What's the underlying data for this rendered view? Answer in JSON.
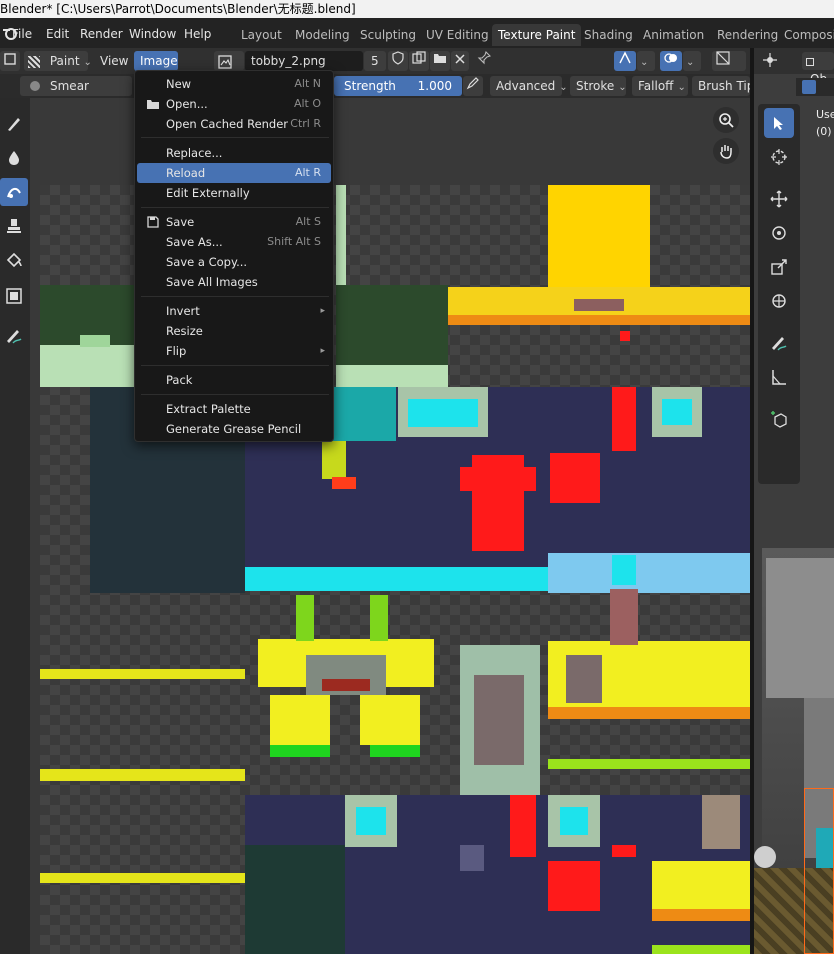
{
  "window": {
    "title": "Blender* [C:\\Users\\Parrot\\Documents\\Blender\\无标题.blend]"
  },
  "menubar": {
    "items": [
      "File",
      "Edit",
      "Render",
      "Window",
      "Help"
    ]
  },
  "workspaces": {
    "tabs": [
      "Layout",
      "Modeling",
      "Sculpting",
      "UV Editing",
      "Texture Paint",
      "Shading",
      "Animation",
      "Rendering",
      "Compositi"
    ],
    "active": "Texture Paint"
  },
  "image_editor_header": {
    "mode": "Paint",
    "view_label": "View",
    "image_label": "Image",
    "image_name": "tobby_2.png",
    "users_count": "5"
  },
  "tool_settings": {
    "brush": "Smear",
    "strength_label": "Strength",
    "strength_value": "1.000",
    "advanced": "Advanced",
    "stroke": "Stroke",
    "falloff": "Falloff",
    "brush_tip": "Brush Tip"
  },
  "image_menu": {
    "items": [
      {
        "label": "New",
        "shortcut": "Alt N"
      },
      {
        "label": "Open...",
        "shortcut": "Alt O"
      },
      {
        "label": "Open Cached Render",
        "shortcut": "Ctrl R"
      },
      {
        "label": "Replace...",
        "shortcut": ""
      },
      {
        "label": "Reload",
        "shortcut": "Alt R"
      },
      {
        "label": "Edit Externally",
        "shortcut": ""
      },
      {
        "label": "Save",
        "shortcut": "Alt S"
      },
      {
        "label": "Save As...",
        "shortcut": "Shift Alt S"
      },
      {
        "label": "Save a Copy...",
        "shortcut": ""
      },
      {
        "label": "Save All Images",
        "shortcut": ""
      },
      {
        "label": "Invert",
        "shortcut": ""
      },
      {
        "label": "Resize",
        "shortcut": ""
      },
      {
        "label": "Flip",
        "shortcut": ""
      },
      {
        "label": "Pack",
        "shortcut": ""
      },
      {
        "label": "Extract Palette",
        "shortcut": ""
      },
      {
        "label": "Generate Grease Pencil",
        "shortcut": ""
      }
    ],
    "highlighted": "Reload"
  },
  "viewport_3d": {
    "header_text": "Ob",
    "overlay_line1": "Use",
    "overlay_line2": "(0)"
  },
  "colors": {
    "accent": "#4772b3",
    "menu_bg": "#181818",
    "header_bg": "#303030",
    "panel_bg": "#2a2a2a"
  },
  "icons": [
    "image-icon",
    "folder-icon",
    "save-icon",
    "pin-icon",
    "zoom-icon",
    "hand-icon",
    "cursor-icon",
    "move-icon",
    "rotate-icon",
    "scale-icon",
    "transform-icon",
    "annotate-icon",
    "measure-icon",
    "add-cube-icon"
  ]
}
